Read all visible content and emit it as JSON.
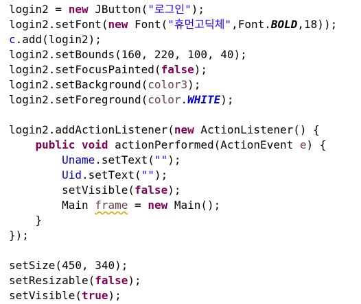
{
  "editor": {
    "lines": [
      [
        {
          "text": "login2 = ",
          "kind": "plain"
        },
        {
          "text": "new",
          "kind": "keyword"
        },
        {
          "text": " JButton(",
          "kind": "plain"
        },
        {
          "text": "\"로그인\"",
          "kind": "string"
        },
        {
          "text": ");",
          "kind": "plain"
        }
      ],
      [
        {
          "text": "login2.setFont(",
          "kind": "plain"
        },
        {
          "text": "new",
          "kind": "keyword"
        },
        {
          "text": " Font(",
          "kind": "plain"
        },
        {
          "text": "\"휴먼고딕체\"",
          "kind": "string"
        },
        {
          "text": ",Font.",
          "kind": "plain"
        },
        {
          "text": "BOLD",
          "kind": "static-italic"
        },
        {
          "text": ",18));",
          "kind": "plain"
        }
      ],
      [
        {
          "text": "c",
          "kind": "field"
        },
        {
          "text": ".add(login2);",
          "kind": "plain"
        }
      ],
      [
        {
          "text": "login2.setBounds(160, 220, 100, 40);",
          "kind": "plain"
        }
      ],
      [
        {
          "text": "login2.setFocusPainted(",
          "kind": "plain"
        },
        {
          "text": "false",
          "kind": "keyword"
        },
        {
          "text": ");",
          "kind": "plain"
        }
      ],
      [
        {
          "text": "login2.setBackground(",
          "kind": "plain"
        },
        {
          "text": "color3",
          "kind": "local"
        },
        {
          "text": ");",
          "kind": "plain"
        }
      ],
      [
        {
          "text": "login2.setForeground(",
          "kind": "plain"
        },
        {
          "text": "color",
          "kind": "local"
        },
        {
          "text": ".",
          "kind": "plain"
        },
        {
          "text": "WHITE",
          "kind": "static-field"
        },
        {
          "text": ");",
          "kind": "plain"
        }
      ],
      [],
      [
        {
          "text": "login2.addActionListener(",
          "kind": "plain"
        },
        {
          "text": "new",
          "kind": "keyword"
        },
        {
          "text": " ActionListener() {",
          "kind": "plain"
        }
      ],
      [
        {
          "text": "    ",
          "kind": "plain"
        },
        {
          "text": "public",
          "kind": "keyword"
        },
        {
          "text": " ",
          "kind": "plain"
        },
        {
          "text": "void",
          "kind": "keyword"
        },
        {
          "text": " actionPerformed(ActionEvent ",
          "kind": "plain"
        },
        {
          "text": "e",
          "kind": "local"
        },
        {
          "text": ") {",
          "kind": "plain"
        }
      ],
      [
        {
          "text": "        ",
          "kind": "plain"
        },
        {
          "text": "Uname",
          "kind": "field"
        },
        {
          "text": ".setText(",
          "kind": "plain"
        },
        {
          "text": "\"\"",
          "kind": "string"
        },
        {
          "text": ");",
          "kind": "plain"
        }
      ],
      [
        {
          "text": "        ",
          "kind": "plain"
        },
        {
          "text": "Uid",
          "kind": "field"
        },
        {
          "text": ".setText(",
          "kind": "plain"
        },
        {
          "text": "\"\"",
          "kind": "string"
        },
        {
          "text": ");",
          "kind": "plain"
        }
      ],
      [
        {
          "text": "        setVisible(",
          "kind": "plain"
        },
        {
          "text": "false",
          "kind": "keyword"
        },
        {
          "text": ");",
          "kind": "plain"
        }
      ],
      [
        {
          "text": "        Main ",
          "kind": "plain"
        },
        {
          "text": "frame",
          "kind": "local-warn"
        },
        {
          "text": " = ",
          "kind": "plain"
        },
        {
          "text": "new",
          "kind": "keyword"
        },
        {
          "text": " Main();",
          "kind": "plain"
        }
      ],
      [
        {
          "text": "    }",
          "kind": "plain"
        }
      ],
      [
        {
          "text": "});",
          "kind": "plain"
        }
      ],
      [],
      [
        {
          "text": "setSize(450, 340);",
          "kind": "plain"
        }
      ],
      [
        {
          "text": "setResizable(",
          "kind": "plain"
        },
        {
          "text": "false",
          "kind": "keyword"
        },
        {
          "text": ");",
          "kind": "plain"
        }
      ],
      [
        {
          "text": "setVisible(",
          "kind": "plain"
        },
        {
          "text": "true",
          "kind": "keyword"
        },
        {
          "text": ");",
          "kind": "plain"
        }
      ]
    ]
  },
  "colors": {
    "background": "#ffffff",
    "plain": "#000000",
    "keyword": "#7f0055",
    "string": "#2a00ff",
    "field": "#0000c0",
    "local": "#6a3e3e",
    "warning_underline": "#d9a400"
  }
}
